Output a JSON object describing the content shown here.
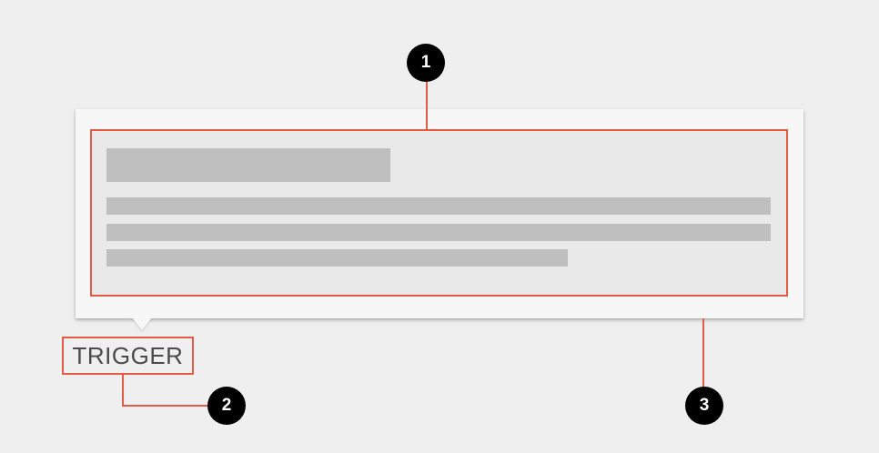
{
  "trigger": {
    "label": "TRIGGER"
  },
  "callouts": {
    "content": "1",
    "trigger": "2",
    "container": "3"
  },
  "colors": {
    "background": "#efefef",
    "popover": "#f7f7f7",
    "content_fill": "#e9e9e9",
    "placeholder": "#bfbfbf",
    "highlight": "#e25b45",
    "callout": "#000000",
    "trigger_text": "#4a4a4a"
  }
}
